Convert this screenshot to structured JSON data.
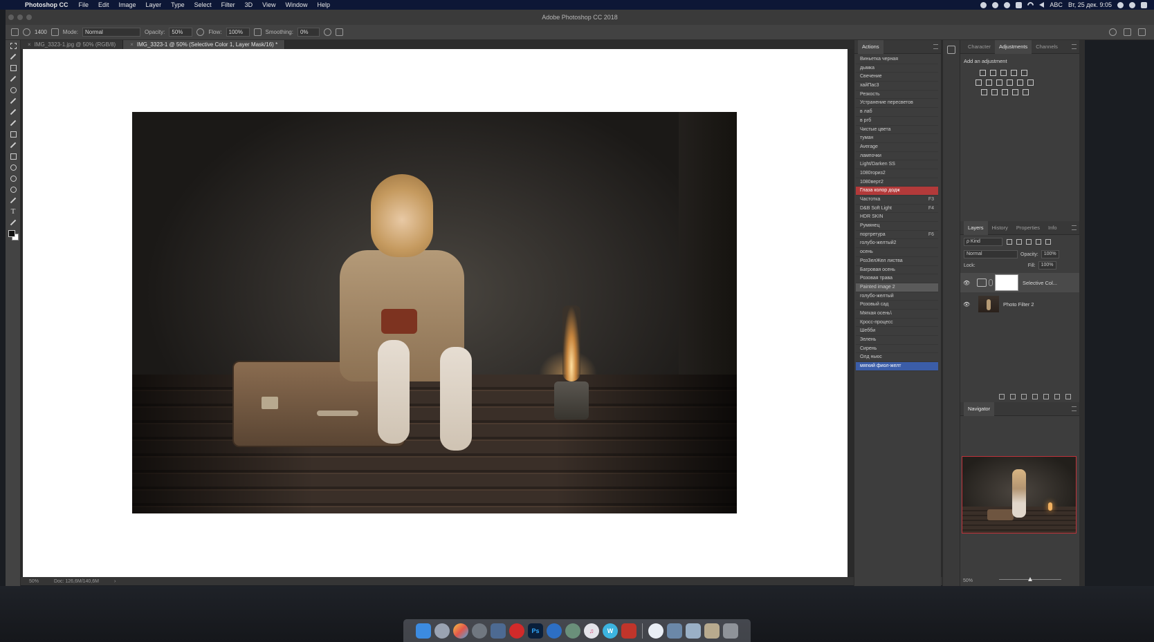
{
  "menubar": {
    "app": "Photoshop CC",
    "items": [
      "File",
      "Edit",
      "Image",
      "Layer",
      "Type",
      "Select",
      "Filter",
      "3D",
      "View",
      "Window",
      "Help"
    ],
    "kb_layout": "ABC",
    "datetime": "Вт, 25 дек. 9:05"
  },
  "window": {
    "title": "Adobe Photoshop CC 2018"
  },
  "options_bar": {
    "brush_size": "1400",
    "mode_label": "Mode:",
    "mode_value": "Normal",
    "opacity_label": "Opacity:",
    "opacity_value": "50%",
    "flow_label": "Flow:",
    "flow_value": "100%",
    "smoothing_label": "Smoothing:",
    "smoothing_value": "0%"
  },
  "tabs": [
    {
      "label": "IMG_3323-1.jpg @ 50% (RGB/8)"
    },
    {
      "label": "IMG_3323-1 @ 50% (Selective Color 1, Layer Mask/16) *"
    }
  ],
  "status": {
    "zoom": "50%",
    "doc": "Doc: 126,6M/140,6M",
    "arrow": "›"
  },
  "actions": {
    "title": "Actions",
    "items": [
      {
        "label": "Виньетка черная",
        "key": ""
      },
      {
        "label": "дымка",
        "key": ""
      },
      {
        "label": "Свечение",
        "key": ""
      },
      {
        "label": "хайПас3",
        "key": ""
      },
      {
        "label": "Резкость",
        "key": ""
      },
      {
        "label": "Устранение пересветов",
        "key": ""
      },
      {
        "label": "в лаб",
        "key": ""
      },
      {
        "label": "в ргб",
        "key": ""
      },
      {
        "label": "Чистые цвета",
        "key": ""
      },
      {
        "label": "туман",
        "key": ""
      },
      {
        "label": "Average",
        "key": ""
      },
      {
        "label": "лампочки",
        "key": ""
      },
      {
        "label": "Light/Darken SS",
        "key": ""
      },
      {
        "label": "1080гориз2",
        "key": ""
      },
      {
        "label": "1080верт2",
        "key": ""
      },
      {
        "label": "Глаза колор додж",
        "key": ""
      },
      {
        "label": "Частотка",
        "key": "F3"
      },
      {
        "label": "D&B Soft Light",
        "key": "F4"
      },
      {
        "label": "HDR SKIN",
        "key": ""
      },
      {
        "label": "Румянец",
        "key": ""
      },
      {
        "label": "портретура",
        "key": "F6"
      },
      {
        "label": "голубо-желтый2",
        "key": ""
      },
      {
        "label": "осень",
        "key": ""
      },
      {
        "label": "РозЗелЖел листва",
        "key": ""
      },
      {
        "label": "Багровая осень",
        "key": ""
      },
      {
        "label": "Розовая трава",
        "key": ""
      },
      {
        "label": "Painted image 2",
        "key": ""
      },
      {
        "label": "голубо-желтый",
        "key": ""
      },
      {
        "label": "Розовый сад",
        "key": ""
      },
      {
        "label": "Мягкая осень\\",
        "key": ""
      },
      {
        "label": "Кросс-процесс",
        "key": ""
      },
      {
        "label": "Шебби",
        "key": ""
      },
      {
        "label": "Зелень",
        "key": ""
      },
      {
        "label": "Сирень",
        "key": ""
      },
      {
        "label": "Олд ньюс",
        "key": ""
      },
      {
        "label": "мягкий фиол-желт",
        "key": ""
      }
    ]
  },
  "adjustments_panel": {
    "tabs": [
      "Character",
      "Adjustments",
      "Channels"
    ],
    "heading": "Add an adjustment"
  },
  "layers_panel": {
    "tabs": [
      "Layers",
      "History",
      "Properties",
      "Info"
    ],
    "kind_label": "ρ Kind",
    "blend_mode": "Normal",
    "opacity_label": "Opacity:",
    "opacity_value": "100%",
    "lock_label": "Lock:",
    "fill_label": "Fill:",
    "fill_value": "100%",
    "layers": [
      {
        "name": "Selective Col..."
      },
      {
        "name": "Photo Filter 2"
      }
    ]
  },
  "navigator_panel": {
    "title": "Navigator",
    "zoom": "50%",
    "slider_level": 0.5
  },
  "colors": {
    "accent_red": "#b33a3a",
    "accent_blue": "#3b5da8",
    "menubar_bg": "#0d1736"
  }
}
